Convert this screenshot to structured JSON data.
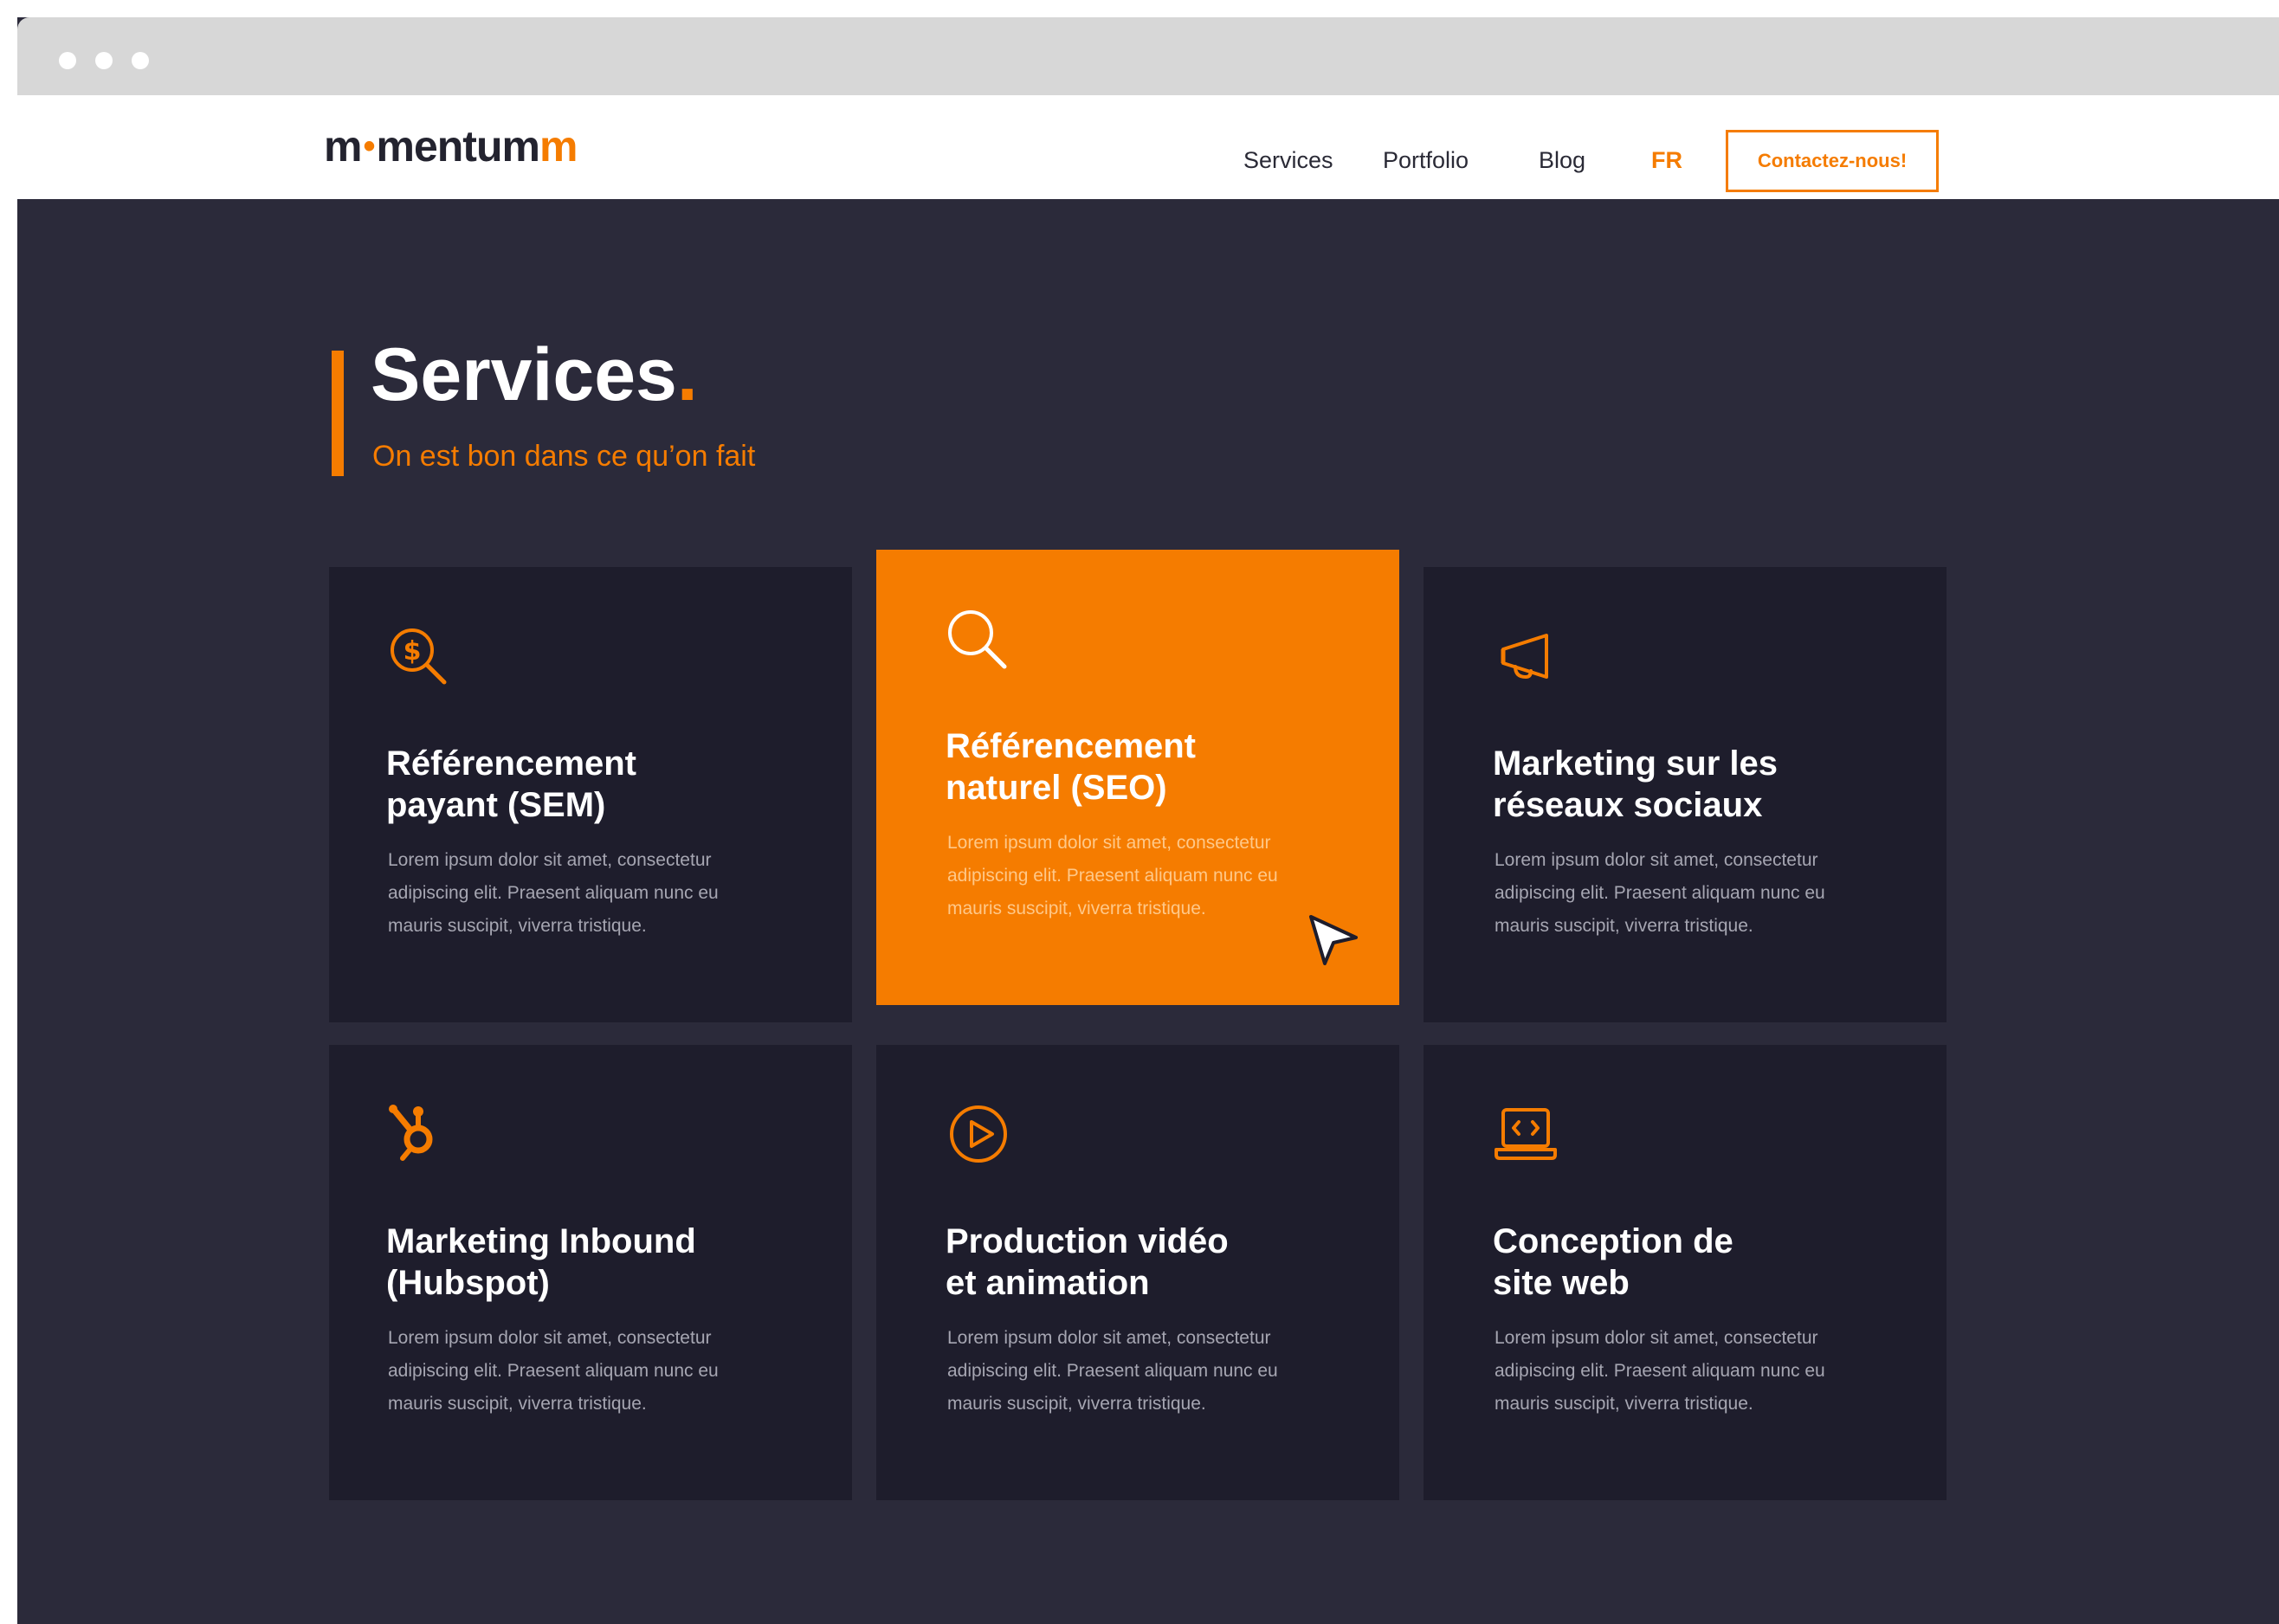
{
  "window": {
    "controls": [
      "close",
      "minimize",
      "maximize"
    ]
  },
  "brand": {
    "logo_part1": "m",
    "logo_dot": "•",
    "logo_part2": "mentum",
    "logo_part3": "m"
  },
  "nav": {
    "items": [
      {
        "label": "Services"
      },
      {
        "label": "Portfolio"
      },
      {
        "label": "Blog"
      }
    ],
    "language": "FR",
    "cta_label": "Contactez-nous!"
  },
  "hero": {
    "title": "Services",
    "title_accent": ".",
    "subtitle": "On est bon dans ce qu’on fait"
  },
  "colors": {
    "accent": "#f57c00",
    "background": "#2b2a3a",
    "card": "#1e1d2c"
  },
  "cards": [
    {
      "icon": "dollar-search-icon",
      "title_line1": "Référencement",
      "title_line2": "payant (SEM)",
      "text_line1": "Lorem ipsum dolor sit amet, consectetur",
      "text_line2": "adipiscing elit. Praesent aliquam nunc eu",
      "text_line3": "mauris suscipit, viverra tristique.",
      "highlighted": false
    },
    {
      "icon": "search-icon",
      "title_line1": "Référencement",
      "title_line2": "naturel (SEO)",
      "text_line1": "Lorem ipsum dolor sit amet, consectetur",
      "text_line2": "adipiscing elit. Praesent aliquam nunc eu",
      "text_line3": "mauris suscipit, viverra tristique.",
      "highlighted": true
    },
    {
      "icon": "megaphone-icon",
      "title_line1": "Marketing sur les",
      "title_line2": "réseaux sociaux",
      "text_line1": "Lorem ipsum dolor sit amet, consectetur",
      "text_line2": "adipiscing elit. Praesent aliquam nunc eu",
      "text_line3": "mauris suscipit, viverra tristique.",
      "highlighted": false
    },
    {
      "icon": "hubspot-icon",
      "title_line1": "Marketing Inbound",
      "title_line2": "(Hubspot)",
      "text_line1": "Lorem ipsum dolor sit amet, consectetur",
      "text_line2": "adipiscing elit. Praesent aliquam nunc eu",
      "text_line3": "mauris suscipit, viverra tristique.",
      "highlighted": false
    },
    {
      "icon": "play-circle-icon",
      "title_line1": "Production vidéo",
      "title_line2": "et animation",
      "text_line1": "Lorem ipsum dolor sit amet, consectetur",
      "text_line2": "adipiscing elit. Praesent aliquam nunc eu",
      "text_line3": "mauris suscipit, viverra tristique.",
      "highlighted": false
    },
    {
      "icon": "laptop-code-icon",
      "title_line1": "Conception de",
      "title_line2": "site web",
      "text_line1": "Lorem ipsum dolor sit amet, consectetur",
      "text_line2": "adipiscing elit. Praesent aliquam nunc eu",
      "text_line3": "mauris suscipit, viverra tristique.",
      "highlighted": false
    }
  ]
}
